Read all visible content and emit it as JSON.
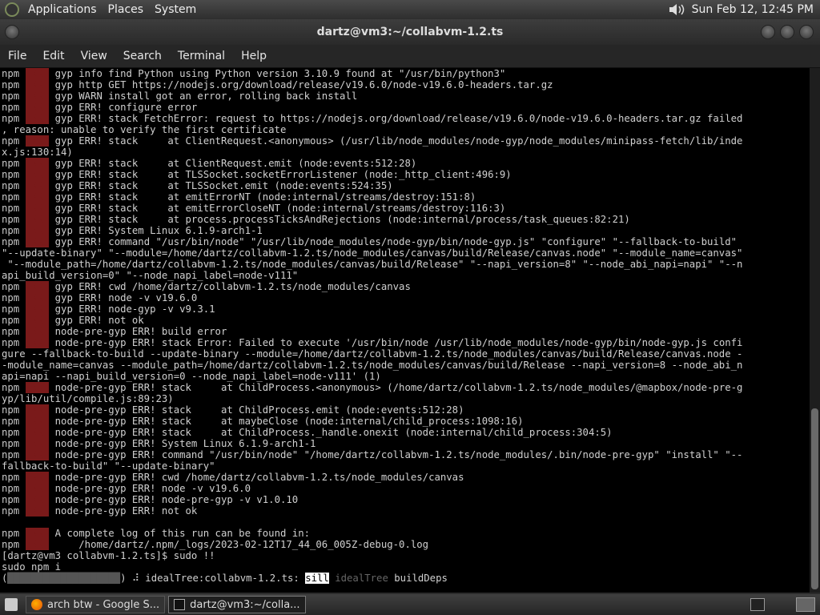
{
  "panel": {
    "menus": [
      "Applications",
      "Places",
      "System"
    ],
    "clock": "Sun Feb 12, 12:45 PM"
  },
  "window": {
    "title": "dartz@vm3:~/collabvm-1.2.ts"
  },
  "menubar": [
    "File",
    "Edit",
    "View",
    "Search",
    "Terminal",
    "Help"
  ],
  "terminal": {
    "prompt": "[dartz@vm3 collabvm-1.2.ts]$ sudo !!",
    "command": "sudo npm i",
    "status_line": {
      "prefix": "(",
      "bar": "███████████████████",
      "mid": ") ⠼ idealTree:collabvm-1.2.ts: ",
      "sill": "sill",
      "idealtree": " idealTree",
      "tail": " buildDeps"
    },
    "lines": [
      [
        "gyp",
        "gyp info find Python using Python version 3.10.9 found at \"/usr/bin/python3\""
      ],
      [
        "gyp",
        "gyp http GET https://nodejs.org/download/release/v19.6.0/node-v19.6.0-headers.tar.gz"
      ],
      [
        "gyp",
        "gyp WARN install got an error, rolling back install"
      ],
      [
        "gyp",
        "gyp ERR! configure error"
      ],
      [
        "gyp",
        "gyp ERR! stack FetchError: request to https://nodejs.org/download/release/v19.6.0/node-v19.6.0-headers.tar.gz failed"
      ],
      [
        "",
        ", reason: unable to verify the first certificate"
      ],
      [
        "gyp",
        "gyp ERR! stack     at ClientRequest.<anonymous> (/usr/lib/node_modules/node-gyp/node_modules/minipass-fetch/lib/inde"
      ],
      [
        "",
        "x.js:130:14)"
      ],
      [
        "gyp",
        "gyp ERR! stack     at ClientRequest.emit (node:events:512:28)"
      ],
      [
        "gyp",
        "gyp ERR! stack     at TLSSocket.socketErrorListener (node:_http_client:496:9)"
      ],
      [
        "gyp",
        "gyp ERR! stack     at TLSSocket.emit (node:events:524:35)"
      ],
      [
        "gyp",
        "gyp ERR! stack     at emitErrorNT (node:internal/streams/destroy:151:8)"
      ],
      [
        "gyp",
        "gyp ERR! stack     at emitErrorCloseNT (node:internal/streams/destroy:116:3)"
      ],
      [
        "gyp",
        "gyp ERR! stack     at process.processTicksAndRejections (node:internal/process/task_queues:82:21)"
      ],
      [
        "gyp",
        "gyp ERR! System Linux 6.1.9-arch1-1"
      ],
      [
        "gyp",
        "gyp ERR! command \"/usr/bin/node\" \"/usr/lib/node_modules/node-gyp/bin/node-gyp.js\" \"configure\" \"--fallback-to-build\""
      ],
      [
        "",
        "\"--update-binary\" \"--module=/home/dartz/collabvm-1.2.ts/node_modules/canvas/build/Release/canvas.node\" \"--module_name=canvas\""
      ],
      [
        "",
        " \"--module_path=/home/dartz/collabvm-1.2.ts/node_modules/canvas/build/Release\" \"--napi_version=8\" \"--node_abi_napi=napi\" \"--n"
      ],
      [
        "",
        "api_build_version=0\" \"--node_napi_label=node-v111\""
      ],
      [
        "gyp",
        "gyp ERR! cwd /home/dartz/collabvm-1.2.ts/node_modules/canvas"
      ],
      [
        "gyp",
        "gyp ERR! node -v v19.6.0"
      ],
      [
        "gyp",
        "gyp ERR! node-gyp -v v9.3.1"
      ],
      [
        "gyp",
        "gyp ERR! not ok"
      ],
      [
        "gyp",
        "node-pre-gyp ERR! build error"
      ],
      [
        "gyp",
        "node-pre-gyp ERR! stack Error: Failed to execute '/usr/bin/node /usr/lib/node_modules/node-gyp/bin/node-gyp.js confi"
      ],
      [
        "",
        "gure --fallback-to-build --update-binary --module=/home/dartz/collabvm-1.2.ts/node_modules/canvas/build/Release/canvas.node -"
      ],
      [
        "",
        "-module_name=canvas --module_path=/home/dartz/collabvm-1.2.ts/node_modules/canvas/build/Release --napi_version=8 --node_abi_n"
      ],
      [
        "",
        "api=napi --napi_build_version=0 --node_napi_label=node-v111' (1)"
      ],
      [
        "gyp",
        "node-pre-gyp ERR! stack     at ChildProcess.<anonymous> (/home/dartz/collabvm-1.2.ts/node_modules/@mapbox/node-pre-g"
      ],
      [
        "",
        "yp/lib/util/compile.js:89:23)"
      ],
      [
        "gyp",
        "node-pre-gyp ERR! stack     at ChildProcess.emit (node:events:512:28)"
      ],
      [
        "gyp",
        "node-pre-gyp ERR! stack     at maybeClose (node:internal/child_process:1098:16)"
      ],
      [
        "gyp",
        "node-pre-gyp ERR! stack     at ChildProcess._handle.onexit (node:internal/child_process:304:5)"
      ],
      [
        "gyp",
        "node-pre-gyp ERR! System Linux 6.1.9-arch1-1"
      ],
      [
        "gyp",
        "node-pre-gyp ERR! command \"/usr/bin/node\" \"/home/dartz/collabvm-1.2.ts/node_modules/.bin/node-pre-gyp\" \"install\" \"--"
      ],
      [
        "",
        "fallback-to-build\" \"--update-binary\""
      ],
      [
        "gyp",
        "node-pre-gyp ERR! cwd /home/dartz/collabvm-1.2.ts/node_modules/canvas"
      ],
      [
        "gyp",
        "node-pre-gyp ERR! node -v v19.6.0"
      ],
      [
        "gyp",
        "node-pre-gyp ERR! node-pre-gyp -v v1.0.10"
      ],
      [
        "gyp",
        "node-pre-gyp ERR! not ok"
      ],
      [
        "",
        ""
      ],
      [
        "err",
        "A complete log of this run can be found in:"
      ],
      [
        "err",
        "    /home/dartz/.npm/_logs/2023-02-12T17_44_06_005Z-debug-0.log"
      ]
    ]
  },
  "taskbar": {
    "tasks": [
      "arch btw - Google S...",
      "dartz@vm3:~/colla..."
    ]
  }
}
